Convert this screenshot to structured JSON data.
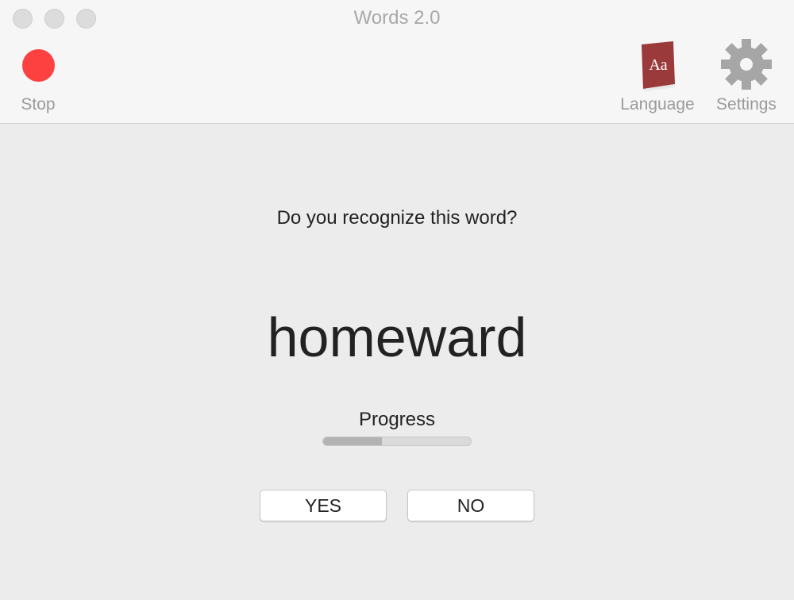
{
  "window": {
    "title": "Words 2.0"
  },
  "toolbar": {
    "stop_label": "Stop",
    "language_label": "Language",
    "settings_label": "Settings",
    "stop_color": "#fd4140",
    "book_color": "#9b3a3a"
  },
  "main": {
    "question": "Do you recognize this word?",
    "word": "homeward",
    "progress_label": "Progress",
    "progress_percent": 40,
    "yes_label": "YES",
    "no_label": "NO"
  }
}
